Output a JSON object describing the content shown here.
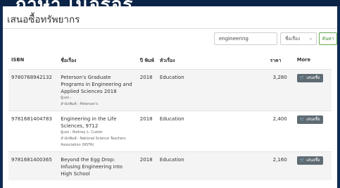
{
  "banner": {
    "text": "ภาษา เนอรีอร"
  },
  "page": {
    "title": "เสนอซื้อทรัพยากร"
  },
  "search": {
    "value": "engineering",
    "select_value": "ชื่อเรื่อง",
    "button_label": "ค้นหา"
  },
  "table": {
    "headers": {
      "isbn": "ISBN",
      "title": "ชื่อเรื่อง",
      "year": "ปี พิมพ์",
      "subject": "หัวเรื่อง",
      "price": "ราคา",
      "more": "More"
    },
    "rows": [
      {
        "isbn": "9780768942132",
        "title": "Peterson's Graduate Programs in Engineering and Applied Sciences 2018",
        "author": "ผู้แต่ง :",
        "publisher": "สำนักพิมพ์ : Peterson's",
        "year": "2018",
        "subject": "Education",
        "price": "3,280",
        "button": "เสนอซื้อ"
      },
      {
        "isbn": "9781681404783",
        "title": "Engineering in the Life Sciences, 9712",
        "author": "ผู้แต่ง : Rodney L. Custer",
        "publisher": "สำนักพิมพ์ : National Science Teachers Association (NSTA)",
        "year": "2018",
        "subject": "Education",
        "price": "2,400",
        "button": "เสนอซื้อ"
      },
      {
        "isbn": "9781681400365",
        "title": "Beyond the Egg Drop: Infusing Engineering into High School",
        "author": "",
        "publisher": "",
        "year": "2018",
        "subject": "Education",
        "price": "2,160",
        "button": "เสนอซื้อ"
      }
    ]
  }
}
